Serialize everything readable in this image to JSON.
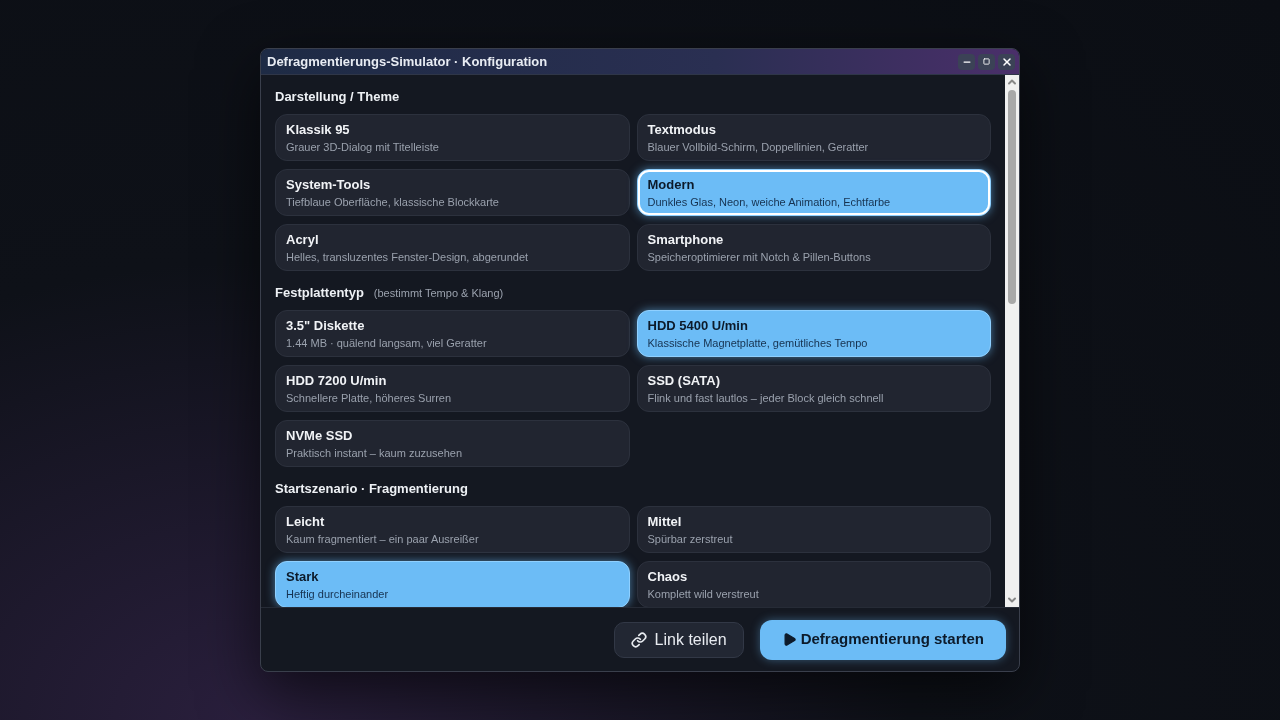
{
  "window": {
    "title": "Defragmentierungs-Simulator · Konfiguration"
  },
  "sections": [
    {
      "title": "Darstellung / Theme",
      "options": [
        {
          "name": "Klassik 95",
          "description": "Grauer 3D-Dialog mit Titelleiste",
          "selected": false,
          "focused": false
        },
        {
          "name": "Textmodus",
          "description": "Blauer Vollbild-Schirm, Doppellinien, Geratter",
          "selected": false,
          "focused": false
        },
        {
          "name": "System-Tools",
          "description": "Tiefblaue Oberfläche, klassische Blockkarte",
          "selected": false,
          "focused": false
        },
        {
          "name": "Modern",
          "description": "Dunkles Glas, Neon, weiche Animation, Echtfarbe",
          "selected": true,
          "focused": true
        },
        {
          "name": "Acryl",
          "description": "Helles, transluzentes Fenster-Design, abgerundet",
          "selected": false,
          "focused": false
        },
        {
          "name": "Smartphone",
          "description": "Speicheroptimierer mit Notch & Pillen-Buttons",
          "selected": false,
          "focused": false
        }
      ]
    },
    {
      "title": "Festplattentyp",
      "hint": "(bestimmt Tempo & Klang)",
      "options": [
        {
          "name": "3.5\" Diskette",
          "description": "1.44 MB · quälend langsam, viel Geratter",
          "selected": false,
          "focused": false
        },
        {
          "name": "HDD 5400 U/min",
          "description": "Klassische Magnetplatte, gemütliches Tempo",
          "selected": true,
          "focused": false
        },
        {
          "name": "HDD 7200 U/min",
          "description": "Schnellere Platte, höheres Surren",
          "selected": false,
          "focused": false
        },
        {
          "name": "SSD (SATA)",
          "description": "Flink und fast lautlos – jeder Block gleich schnell",
          "selected": false,
          "focused": false
        },
        {
          "name": "NVMe SSD",
          "description": "Praktisch instant – kaum zuzusehen",
          "selected": false,
          "focused": false
        }
      ]
    },
    {
      "title": "Startszenario · Fragmentierung",
      "options": [
        {
          "name": "Leicht",
          "description": "Kaum fragmentiert – ein paar Ausreißer",
          "selected": false,
          "focused": false
        },
        {
          "name": "Mittel",
          "description": "Spürbar zerstreut",
          "selected": false,
          "focused": false
        },
        {
          "name": "Stark",
          "description": "Heftig durcheinander",
          "selected": true,
          "focused": false
        },
        {
          "name": "Chaos",
          "description": "Komplett wild verstreut",
          "selected": false,
          "focused": false
        }
      ]
    }
  ],
  "footer": {
    "share_button": "Link teilen",
    "start_button": "Defragmentierung starten"
  }
}
